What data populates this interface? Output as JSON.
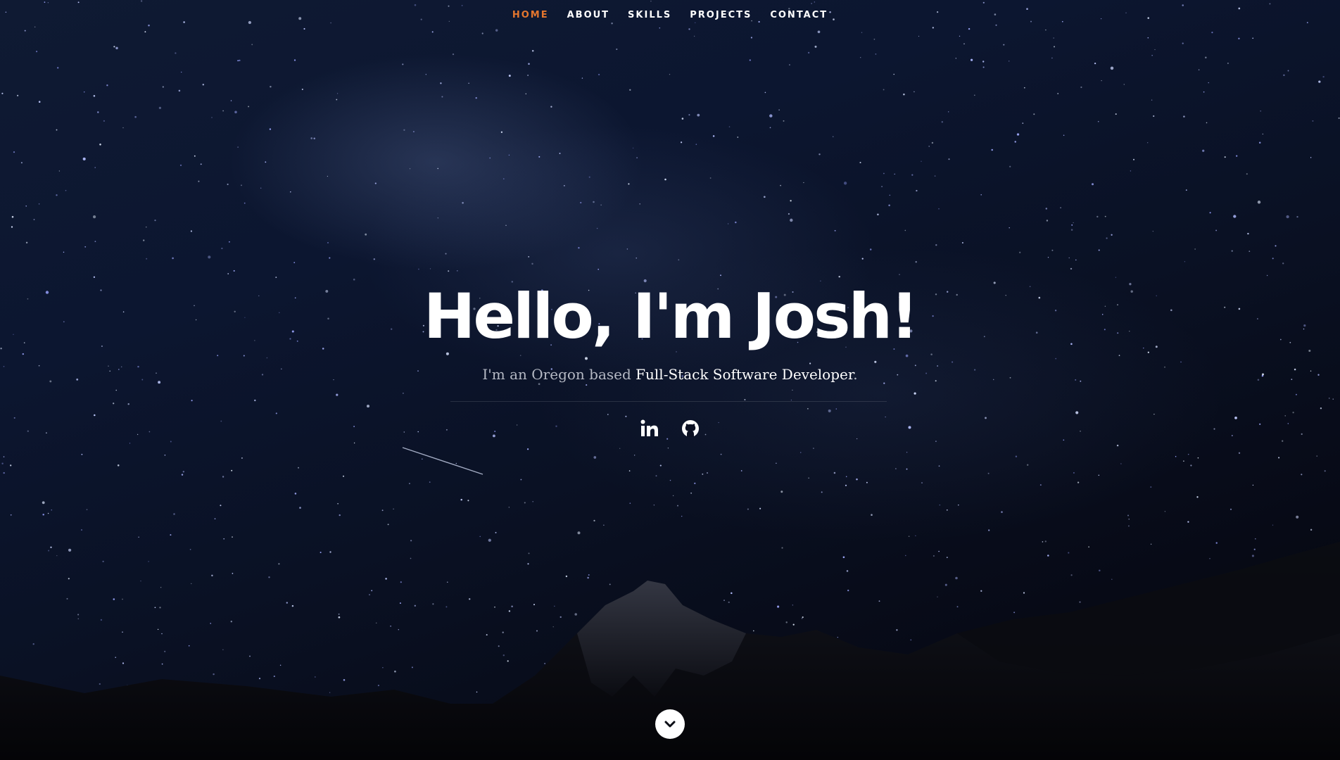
{
  "nav": {
    "items": [
      {
        "label": "HOME",
        "active": true
      },
      {
        "label": "ABOUT",
        "active": false
      },
      {
        "label": "SKILLS",
        "active": false
      },
      {
        "label": "PROJECTS",
        "active": false
      },
      {
        "label": "CONTACT",
        "active": false
      }
    ],
    "active_color": "#e4762e"
  },
  "hero": {
    "title": "Hello, I'm Josh!",
    "subtitle_prefix": "I'm an Oregon based ",
    "subtitle_highlight": "Full-Stack Software Developer",
    "subtitle_suffix": "."
  },
  "social": {
    "links": [
      {
        "icon": "linkedin-icon"
      },
      {
        "icon": "github-icon"
      }
    ]
  },
  "scroll_down": {
    "icon": "chevron-down-icon"
  }
}
